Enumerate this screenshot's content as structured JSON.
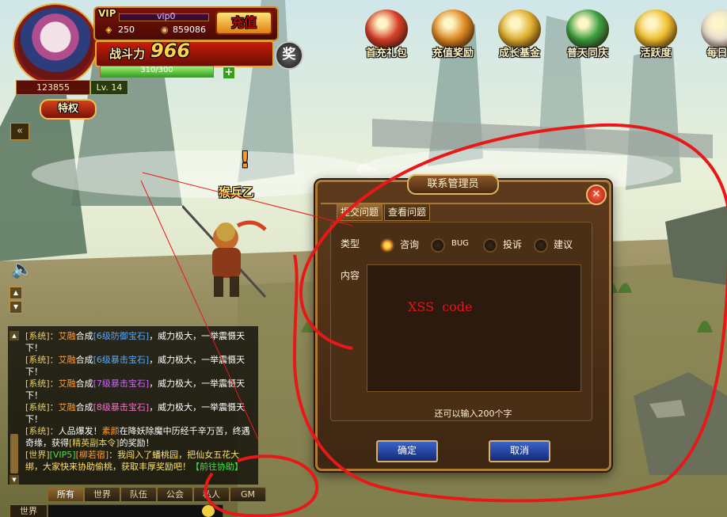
{
  "hud": {
    "vip_label": "VIP",
    "vip_level": "vip0",
    "gold": "250",
    "coins": "859086",
    "recharge": "充值",
    "power_label": "战斗力",
    "power_value": "966",
    "reward": "奖",
    "hp": "310/300",
    "player_id": "123855",
    "level": "Lv. 14",
    "privilege": "特权"
  },
  "features": [
    {
      "label": "首充礼包",
      "color": "#d8402a",
      "icon": "gift-bag-icon"
    },
    {
      "label": "充值奖励",
      "color": "#e08a24",
      "icon": "treasure-bag-icon"
    },
    {
      "label": "成长基金",
      "color": "#e0b030",
      "icon": "gold-chart-icon"
    },
    {
      "label": "普天同庆",
      "color": "#3aa040",
      "icon": "money-tree-icon"
    },
    {
      "label": "活跃度",
      "color": "#f0c030",
      "icon": "star-icon"
    },
    {
      "label": "每日签",
      "color": "#e8e0d0",
      "icon": "calendar-icon"
    }
  ],
  "npc_name": "猴兵乙",
  "chat": {
    "lines": [
      {
        "prefix": "[系统]：",
        "name": "艾融",
        "verb": "合成",
        "item": "[6级防御宝石]",
        "tail": "，威力极大，一举震慑天下！",
        "gem": "gem-b"
      },
      {
        "prefix": "[系统]：",
        "name": "艾融",
        "verb": "合成",
        "item": "[6级暴击宝石]",
        "tail": "，威力极大，一举震慑天下！",
        "gem": "gem-b"
      },
      {
        "prefix": "[系统]：",
        "name": "艾融",
        "verb": "合成",
        "item": "[7级暴击宝石]",
        "tail": "，威力极大，一举震慑天下！",
        "gem": "gem-p"
      },
      {
        "prefix": "[系统]：",
        "name": "艾融",
        "verb": "合成",
        "item": "[8级暴击宝石]",
        "tail": "，威力极大，一举震慑天下！",
        "gem": "gem-r"
      }
    ],
    "luck_line": {
      "prefix": "[系统]：",
      "text1": "人品爆发！",
      "name": "素颜",
      "text2": "在降妖除魔中历经千辛万苦，终遇奇缘，获得",
      "item": "[精英副本令]",
      "text3": "的奖励！"
    },
    "world_line": {
      "channel": "[世界]",
      "vip": "[VIP5]",
      "name": "[柳若宿]",
      "text": "：我闯入了蟠桃园，把仙女五花大绑，大家快来协助偷桃，获取丰厚奖励吧！",
      "link": "【前往协助】"
    },
    "tabs": [
      "所有",
      "世界",
      "队伍",
      "公会",
      "私人",
      "GM"
    ],
    "channel_select": "世界"
  },
  "dialog": {
    "title": "联系管理员",
    "tab_submit": "提交问题",
    "tab_view": "查看问题",
    "type_label": "类型",
    "options": [
      "咨询",
      "BUG",
      "投诉",
      "建议"
    ],
    "selected_option": "咨询",
    "content_label": "内容",
    "content_value": "XSS  code",
    "remaining": "还可以输入200个字",
    "confirm": "确定",
    "cancel": "取消"
  }
}
